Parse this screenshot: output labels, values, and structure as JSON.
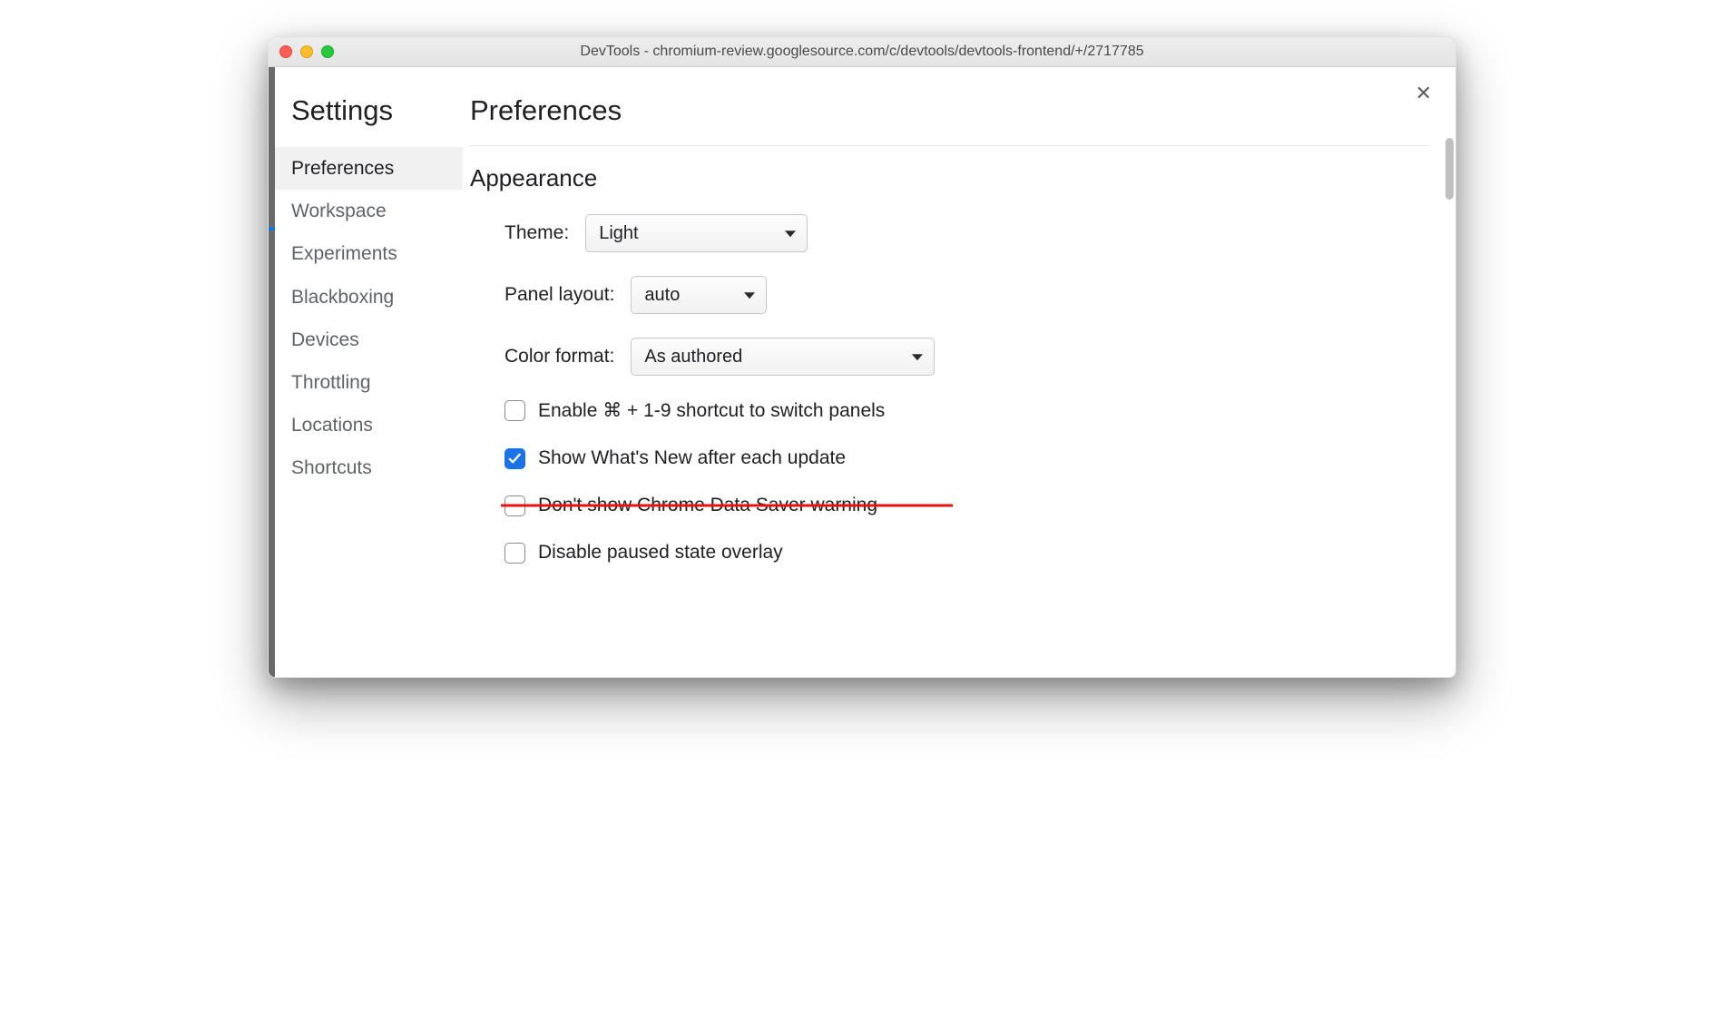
{
  "window": {
    "title_prefix": "DevTools - ",
    "title_url": "chromium-review.googlesource.com/c/devtools/devtools-frontend/+/2717785"
  },
  "sidebar": {
    "title": "Settings",
    "items": [
      {
        "label": "Preferences",
        "active": true
      },
      {
        "label": "Workspace",
        "active": false
      },
      {
        "label": "Experiments",
        "active": false
      },
      {
        "label": "Blackboxing",
        "active": false
      },
      {
        "label": "Devices",
        "active": false
      },
      {
        "label": "Throttling",
        "active": false
      },
      {
        "label": "Locations",
        "active": false
      },
      {
        "label": "Shortcuts",
        "active": false
      }
    ]
  },
  "main": {
    "title": "Preferences",
    "appearance": {
      "heading": "Appearance",
      "theme_label": "Theme:",
      "theme_value": "Light",
      "panel_label": "Panel layout:",
      "panel_value": "auto",
      "color_label": "Color format:",
      "color_value": "As authored",
      "chk_shortcut": "Enable ⌘ + 1-9 shortcut to switch panels",
      "chk_whatsnew": "Show What's New after each update",
      "chk_datasaver": "Don't show Chrome Data Saver warning",
      "chk_paused": "Disable paused state overlay"
    }
  },
  "close_glyph": "✕"
}
